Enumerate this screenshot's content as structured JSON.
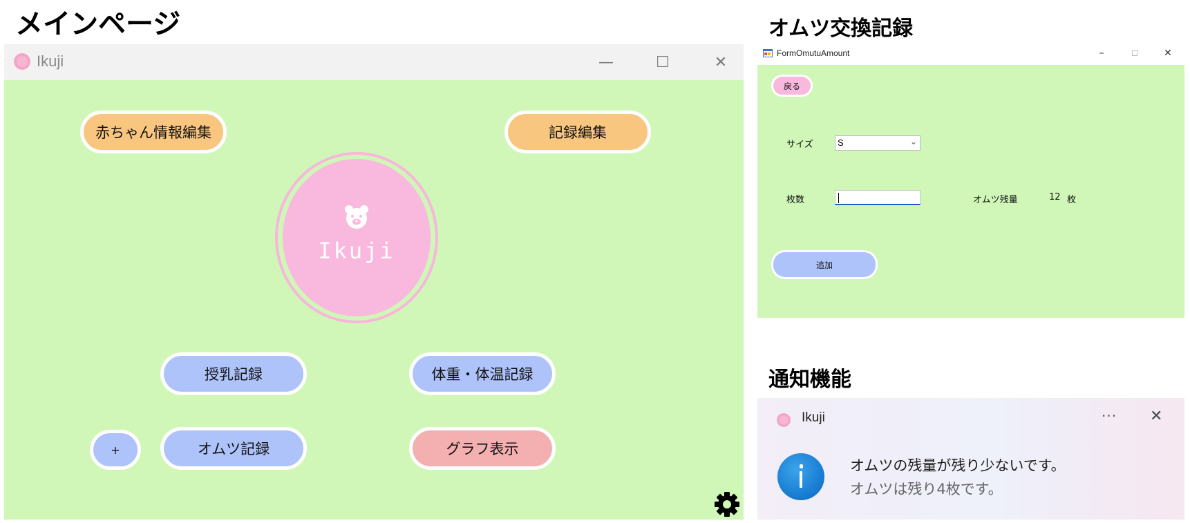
{
  "sections": {
    "main_heading": "メインページ",
    "omutu_heading": "オムツ交換記録",
    "notif_heading": "通知機能"
  },
  "main_window": {
    "title": "Ikuji",
    "controls": {
      "minimize": "—",
      "maximize": "☐",
      "close": "✕"
    },
    "buttons": {
      "baby_info": "赤ちゃん情報編集",
      "record_edit": "記録編集",
      "feeding": "授乳記録",
      "weight_temp": "体重・体温記録",
      "plus": "+",
      "diaper": "オムツ記録",
      "graph": "グラフ表示"
    },
    "logo_text": "Ikuji",
    "colors": {
      "background": "#d0f7b8",
      "orange": "#f9c680",
      "blue": "#aec3f9",
      "pink_button": "#f4b0b0",
      "logo": "#f9b8dd"
    }
  },
  "omutu_window": {
    "title": "FormOmutuAmount",
    "controls": {
      "minimize": "–",
      "maximize": "☐",
      "close": "✕"
    },
    "back_button": "戻る",
    "size_label": "サイズ",
    "size_value": "S",
    "count_label": "枚数",
    "count_value": "",
    "remaining_label": "オムツ残量",
    "remaining_value": "12",
    "remaining_unit": "枚",
    "add_button": "追加"
  },
  "notification": {
    "app": "Ikuji",
    "more": "···",
    "close": "✕",
    "message": "オムツの残量が残り少ないです。",
    "detail": "オムツは残り4枚です。"
  }
}
